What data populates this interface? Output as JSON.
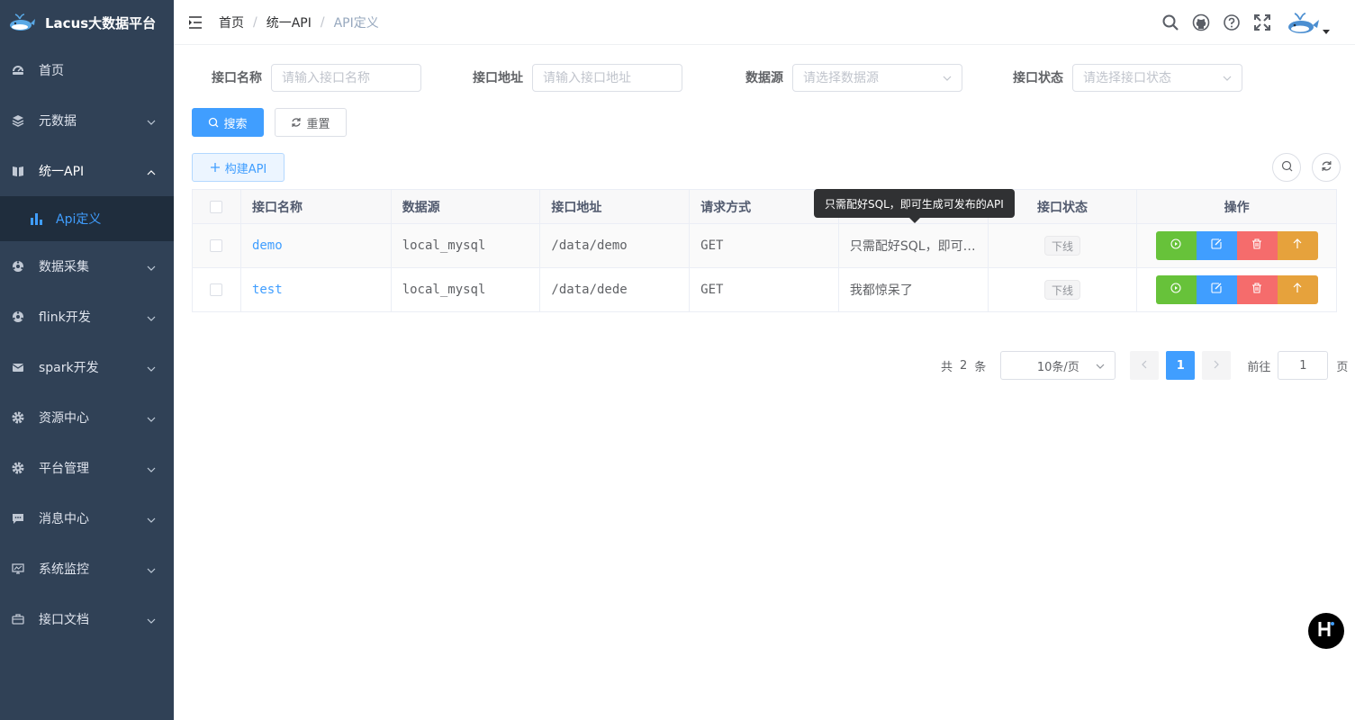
{
  "app": {
    "title": "Lacus大数据平台"
  },
  "sidebar": {
    "items": [
      {
        "label": "首页",
        "icon": "dashboard-icon"
      },
      {
        "label": "元数据",
        "icon": "layers-icon"
      },
      {
        "label": "统一API",
        "icon": "book-icon"
      },
      {
        "label": "数据采集",
        "icon": "network-icon"
      },
      {
        "label": "flink开发",
        "icon": "network-icon"
      },
      {
        "label": "spark开发",
        "icon": "mail-icon"
      },
      {
        "label": "资源中心",
        "icon": "gear-icon"
      },
      {
        "label": "平台管理",
        "icon": "gear-icon"
      },
      {
        "label": "消息中心",
        "icon": "chat-icon"
      },
      {
        "label": "系统监控",
        "icon": "monitor-icon"
      },
      {
        "label": "接口文档",
        "icon": "briefcase-icon"
      }
    ],
    "sub_items": [
      {
        "label": "Api定义",
        "icon": "bar-chart-icon"
      }
    ]
  },
  "breadcrumb": {
    "home": "首页",
    "section": "统一API",
    "page": "API定义",
    "separator": "/"
  },
  "search": {
    "name_label": "接口名称",
    "name_placeholder": "请输入接口名称",
    "url_label": "接口地址",
    "url_placeholder": "请输入接口地址",
    "source_label": "数据源",
    "source_placeholder": "请选择数据源",
    "status_label": "接口状态",
    "status_placeholder": "请选择接口状态",
    "search_button": "搜索",
    "reset_button": "重置"
  },
  "toolbar": {
    "build_button": "构建API"
  },
  "table": {
    "headers": [
      "接口名称",
      "数据源",
      "接口地址",
      "请求方式",
      "",
      "接口状态",
      "操作"
    ],
    "rows": [
      {
        "name": "demo",
        "source": "local_mysql",
        "url": "/data/demo",
        "method": "GET",
        "desc": "只需配好SQL，即可…",
        "status": "下线"
      },
      {
        "name": "test",
        "source": "local_mysql",
        "url": "/data/dede",
        "method": "GET",
        "desc": "我都惊呆了",
        "status": "下线"
      }
    ]
  },
  "tooltip": {
    "text": "只需配好SQL，即可生成可发布的API"
  },
  "pagination": {
    "total_prefix": "共",
    "total": "2",
    "total_suffix": "条",
    "page_size": "10条/页",
    "current_page": "1",
    "goto_label": "前往",
    "goto_value": "1",
    "goto_suffix": "页"
  },
  "colors": {
    "sidebar_bg": "#304156",
    "primary": "#409eff",
    "success": "#67c23a",
    "danger": "#f56c6c",
    "warning": "#e6a23c"
  }
}
